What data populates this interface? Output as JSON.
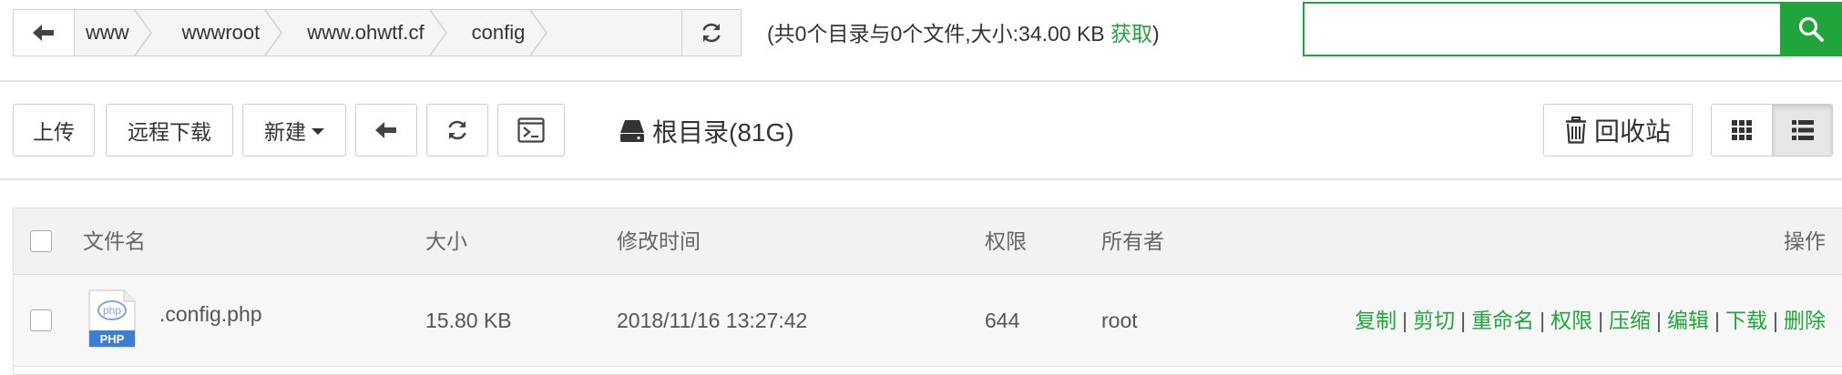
{
  "path": {
    "segments": [
      "www",
      "wwwroot",
      "www.ohwtf.cf",
      "config"
    ],
    "info_prefix": "(共0个目录与0个文件,大小:34.00 KB ",
    "info_link": "获取",
    "info_suffix": ")"
  },
  "search": {
    "placeholder": "",
    "value": ""
  },
  "toolbar": {
    "upload": "上传",
    "remote_download": "远程下载",
    "new": "新建",
    "root_dir": "根目录(81G)",
    "recycle_bin": "回收站"
  },
  "table": {
    "headers": {
      "name": "文件名",
      "size": "大小",
      "mtime": "修改时间",
      "perm": "权限",
      "owner": "所有者",
      "ops": "操作"
    },
    "rows": [
      {
        "icon_label": "PHP",
        "icon_badge": "php",
        "name": ".config.php",
        "size": "15.80 KB",
        "mtime": "2018/11/16 13:27:42",
        "perm": "644",
        "owner": "root"
      }
    ],
    "actions": [
      "复制",
      "剪切",
      "重命名",
      "权限",
      "压缩",
      "编辑",
      "下载",
      "删除"
    ]
  },
  "colors": {
    "accent": "#20a53a",
    "file_icon": "#3b7fd4"
  }
}
